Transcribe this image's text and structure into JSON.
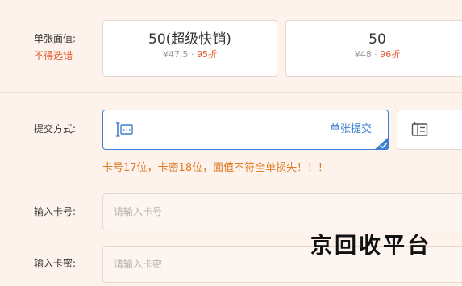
{
  "denomination": {
    "label": "单张面值:",
    "note": "不得选错",
    "options": [
      {
        "title": "50(超级快销)",
        "price": "¥47.5",
        "separator": " · ",
        "discount": "95折",
        "selected": false
      },
      {
        "title": "50",
        "price": "¥48",
        "separator": " · ",
        "discount": "96折",
        "selected": false
      }
    ]
  },
  "submit_method": {
    "label": "提交方式:",
    "options": [
      {
        "label": "单张提交",
        "icon": "single-card-icon",
        "selected": true
      },
      {
        "label": "",
        "icon": "batch-card-icon",
        "selected": false
      }
    ],
    "warning": "卡号17位，卡密18位，面值不符全单损失！！！"
  },
  "card_number": {
    "label": "输入卡号:",
    "placeholder": "请输入卡号",
    "value": ""
  },
  "card_password": {
    "label": "输入卡密:",
    "placeholder": "请输入卡密",
    "value": ""
  },
  "watermark": "京回收平台",
  "colors": {
    "background": "#fdf3ec",
    "accent_blue": "#3f7fd1",
    "discount_red": "#e4572e",
    "warning_orange": "#e07a22",
    "border": "#e6d8cf"
  }
}
